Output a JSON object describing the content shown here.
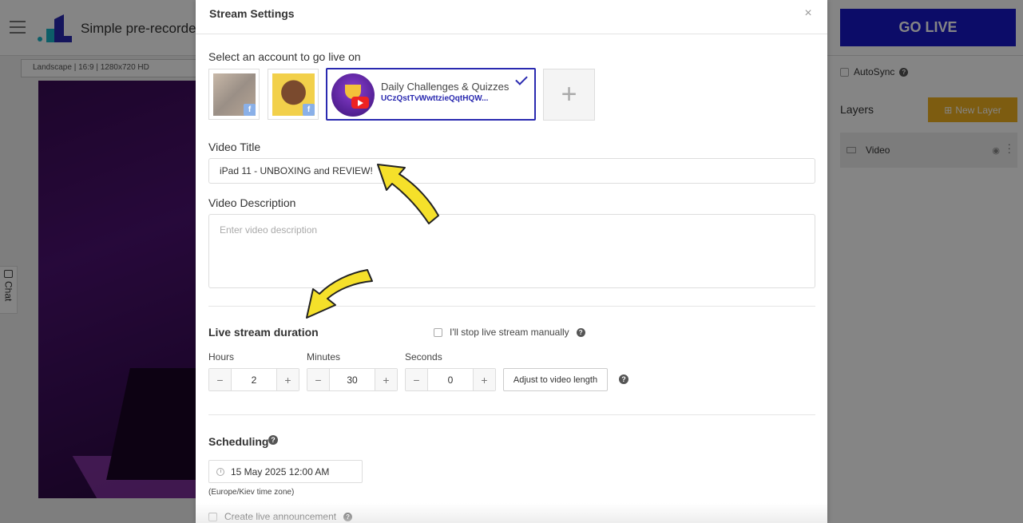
{
  "app": {
    "title": "Simple pre-recorded",
    "go_live_label": "GO LIVE",
    "format_select": "Landscape | 16:9 | 1280x720 HD",
    "chat_tab_label": "Chat",
    "autosync_label": "AutoSync",
    "layers_label": "Layers",
    "new_layer_label": "New Layer",
    "layer_name": "Video",
    "colors": {
      "go_live": "#1717c8",
      "new_layer": "#f0b020"
    }
  },
  "modal": {
    "title": "Stream Settings",
    "accounts": {
      "section_label": "Select an account to go live on",
      "selected_name": "Daily Challenges & Quizzes",
      "selected_id": "UCzQstTvWwttzieQqtHQW...",
      "fb_badge": "f",
      "add_label": "+"
    },
    "video_title": {
      "label": "Video Title",
      "value": "iPad 11 - UNBOXING and REVIEW!"
    },
    "video_description": {
      "label": "Video Description",
      "placeholder": "Enter video description"
    },
    "duration": {
      "label": "Live stream duration",
      "manual_stop_label": "I'll stop live stream manually",
      "hours_label": "Hours",
      "hours_value": "2",
      "minutes_label": "Minutes",
      "minutes_value": "30",
      "seconds_label": "Seconds",
      "seconds_value": "0",
      "minus": "−",
      "plus": "+",
      "adjust_label": "Adjust to video length"
    },
    "scheduling": {
      "label": "Scheduling",
      "datetime": "15 May 2025 12:00 AM",
      "timezone_note": "(Europe/Kiev time zone)",
      "announce_label": "Create live announcement"
    },
    "help_glyph": "?",
    "close_glyph": "×",
    "colors": {
      "accent": "#2a2ab0",
      "arrow_fill": "#f5e02a"
    }
  }
}
